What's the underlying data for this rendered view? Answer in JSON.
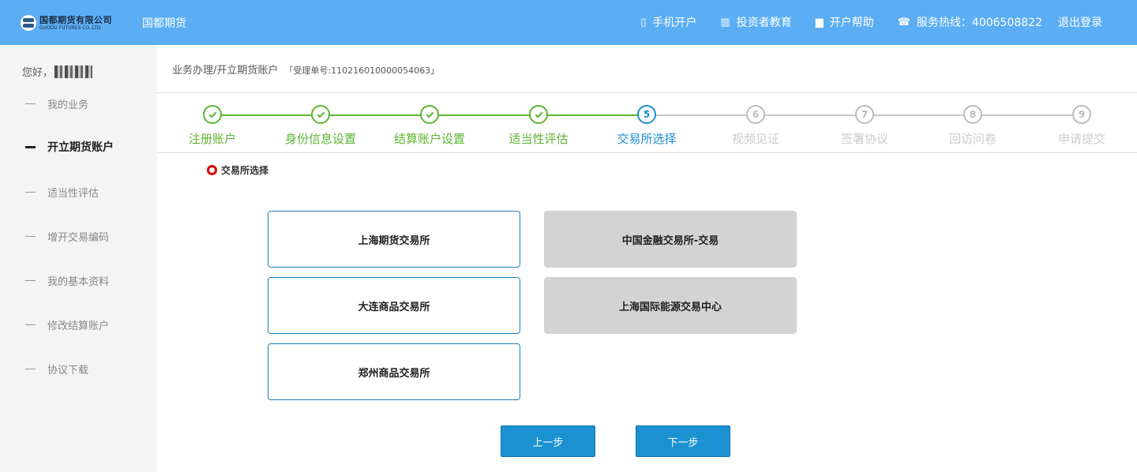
{
  "header": {
    "logo_cn": "国都期货有限公司",
    "logo_en": "GUODU FUTURES CO.,LTD",
    "brand": "国都期货",
    "nav": [
      {
        "icon": "mobile-phone-icon",
        "label": "手机开户"
      },
      {
        "icon": "books-icon",
        "label": "投资者教育"
      },
      {
        "icon": "bookmark-icon",
        "label": "开户帮助"
      },
      {
        "icon": "telephone-icon",
        "label": "服务热线：4006508822"
      }
    ],
    "logout": "退出登录",
    "bg_color": "#5baef4"
  },
  "sidebar": {
    "greeting": "您好，",
    "items": [
      {
        "label": "我的业务",
        "active": false
      },
      {
        "label": "开立期货账户",
        "active": true
      },
      {
        "label": "适当性评估",
        "active": false
      },
      {
        "label": "增开交易编码",
        "active": false
      },
      {
        "label": "我的基本资料",
        "active": false
      },
      {
        "label": "修改结算账户",
        "active": false
      },
      {
        "label": "协议下载",
        "active": false
      }
    ]
  },
  "breadcrumb": {
    "path": "业务办理/开立期货账户",
    "order": "「受理单号:110216010000054063」"
  },
  "steps": [
    {
      "num": "1",
      "label": "注册账户",
      "status": "done"
    },
    {
      "num": "2",
      "label": "身份信息设置",
      "status": "done"
    },
    {
      "num": "3",
      "label": "结算账户设置",
      "status": "done"
    },
    {
      "num": "4",
      "label": "适当性评估",
      "status": "done"
    },
    {
      "num": "5",
      "label": "交易所选择",
      "status": "current"
    },
    {
      "num": "6",
      "label": "视频见证",
      "status": "todo"
    },
    {
      "num": "7",
      "label": "签署协议",
      "status": "todo"
    },
    {
      "num": "8",
      "label": "回访问卷",
      "status": "todo"
    },
    {
      "num": "9",
      "label": "申请提交",
      "status": "todo"
    }
  ],
  "section_title": "交易所选择",
  "exchanges": [
    {
      "label": "上海期货交易所",
      "enabled": true
    },
    {
      "label": "中国金融交易所-交易",
      "enabled": false
    },
    {
      "label": "大连商品交易所",
      "enabled": true
    },
    {
      "label": "上海国际能源交易中心",
      "enabled": false
    },
    {
      "label": "郑州商品交易所",
      "enabled": true
    }
  ],
  "buttons": {
    "prev": "上一步",
    "next": "下一步"
  },
  "colors": {
    "done": "#5cb531",
    "current": "#1b8fd3",
    "todo": "#bbbbbb",
    "button": "#1b91d1"
  }
}
